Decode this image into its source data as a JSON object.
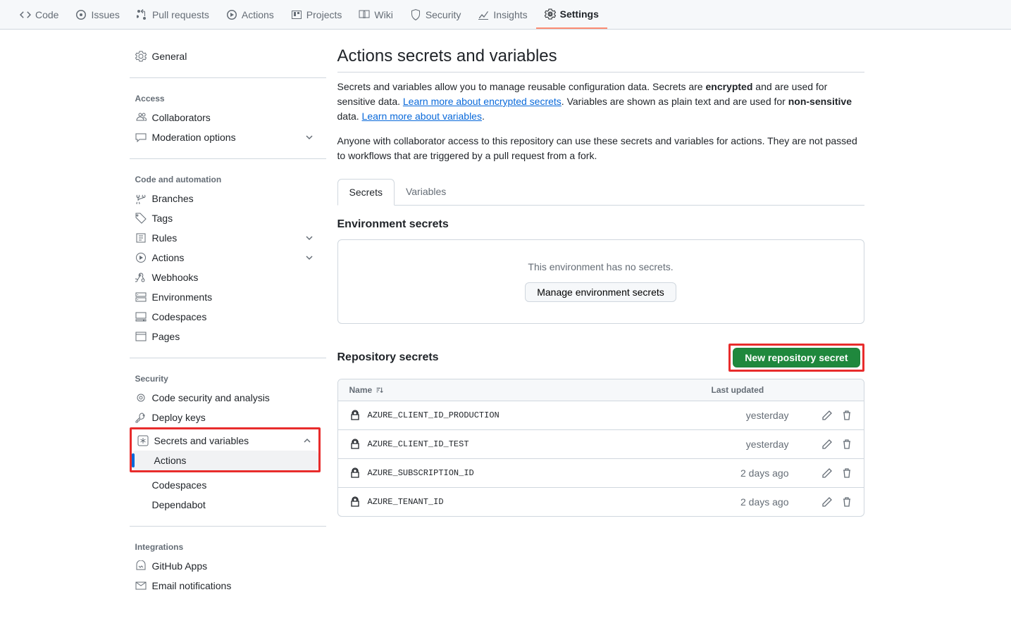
{
  "topnav": [
    {
      "label": "Code"
    },
    {
      "label": "Issues"
    },
    {
      "label": "Pull requests"
    },
    {
      "label": "Actions"
    },
    {
      "label": "Projects"
    },
    {
      "label": "Wiki"
    },
    {
      "label": "Security"
    },
    {
      "label": "Insights"
    },
    {
      "label": "Settings"
    }
  ],
  "sidebar": {
    "general": "General",
    "access_header": "Access",
    "collaborators": "Collaborators",
    "moderation": "Moderation options",
    "code_header": "Code and automation",
    "branches": "Branches",
    "tags": "Tags",
    "rules": "Rules",
    "actions": "Actions",
    "webhooks": "Webhooks",
    "environments": "Environments",
    "codespaces": "Codespaces",
    "pages": "Pages",
    "security_header": "Security",
    "code_security": "Code security and analysis",
    "deploy_keys": "Deploy keys",
    "secrets_vars": "Secrets and variables",
    "sv_actions": "Actions",
    "sv_codespaces": "Codespaces",
    "sv_dependabot": "Dependabot",
    "integrations_header": "Integrations",
    "github_apps": "GitHub Apps",
    "email_notif": "Email notifications"
  },
  "main": {
    "title": "Actions secrets and variables",
    "desc1_a": "Secrets and variables allow you to manage reusable configuration data. Secrets are ",
    "desc1_b": "encrypted",
    "desc1_c": " and are used for sensitive data. ",
    "link1": "Learn more about encrypted secrets",
    "desc1_d": ". Variables are shown as plain text and are used for ",
    "desc1_e": "non-sensitive",
    "desc1_f": " data. ",
    "link2": "Learn more about variables",
    "desc1_g": ".",
    "desc2": "Anyone with collaborator access to this repository can use these secrets and variables for actions. They are not passed to workflows that are triggered by a pull request from a fork.",
    "tab_secrets": "Secrets",
    "tab_variables": "Variables",
    "env_title": "Environment secrets",
    "env_msg": "This environment has no secrets.",
    "env_btn": "Manage environment secrets",
    "repo_title": "Repository secrets",
    "new_btn": "New repository secret",
    "col_name": "Name",
    "col_updated": "Last updated",
    "secrets": [
      {
        "name": "AZURE_CLIENT_ID_PRODUCTION",
        "updated": "yesterday"
      },
      {
        "name": "AZURE_CLIENT_ID_TEST",
        "updated": "yesterday"
      },
      {
        "name": "AZURE_SUBSCRIPTION_ID",
        "updated": "2 days ago"
      },
      {
        "name": "AZURE_TENANT_ID",
        "updated": "2 days ago"
      }
    ]
  }
}
